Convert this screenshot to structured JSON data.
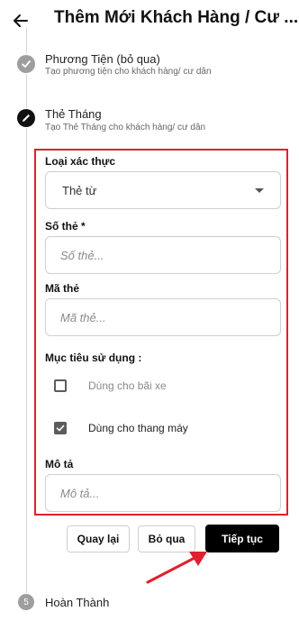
{
  "header": {
    "title": "Thêm Mới Khách Hàng / Cư ..."
  },
  "steps": [
    {
      "title": "Phương Tiện (bỏ qua)",
      "subtitle": "Tạo phương tiện cho khách hàng/ cư dân"
    },
    {
      "title": "Thẻ Tháng",
      "subtitle": "Tạo Thẻ Tháng cho khách hàng/ cư dân"
    },
    {
      "number": "5",
      "title": "Hoàn Thành"
    }
  ],
  "form": {
    "auth_type_label": "Loại xác thực",
    "auth_type_value": "Thẻ từ",
    "card_number_label": "Số thẻ *",
    "card_number_placeholder": "Số thẻ...",
    "card_code_label": "Mã thẻ",
    "card_code_placeholder": "Mã thẻ...",
    "usage_label": "Mục tiêu sử dụng :",
    "usage_options": [
      {
        "label": "Dùng cho bãi xe",
        "checked": false
      },
      {
        "label": "Dùng cho thang máy",
        "checked": true
      }
    ],
    "description_label": "Mô tả",
    "description_placeholder": "Mô tả..."
  },
  "actions": {
    "back": "Quay lại",
    "skip": "Bỏ qua",
    "next": "Tiếp tục"
  },
  "colors": {
    "annotation": "#e0202d",
    "primary": "#000000",
    "done_step": "#9e9e9e"
  }
}
